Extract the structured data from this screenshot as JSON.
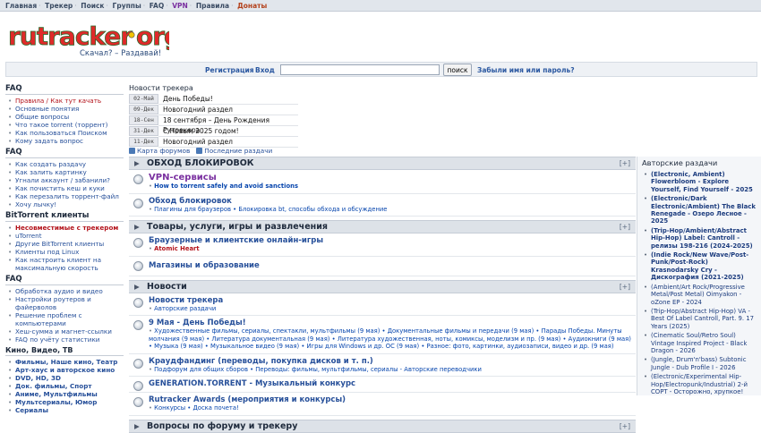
{
  "topnav": [
    "Главная",
    "Трекер",
    "Поиск",
    "Группы",
    "FAQ",
    "VPN",
    "Правила",
    "Донаты"
  ],
  "logo": {
    "text": "rutracker.org",
    "slogan": "Скачал? – Раздавай!"
  },
  "login": {
    "register": "Регистрация",
    "login": "Вход",
    "search_value": "",
    "search_button": "поиск",
    "forgot": "Забыли имя или пароль?"
  },
  "left": {
    "faq1": {
      "title": "FAQ",
      "items": [
        "Правила / Как тут качать",
        "Основные понятия",
        "Общие вопросы",
        "Что такое torrent (торрент)",
        "Как пользоваться Поиском",
        "Кому задать вопрос"
      ]
    },
    "faq2": {
      "title": "FAQ",
      "items": [
        "Как создать раздачу",
        "Как залить картинку",
        "Угнали аккаунт / забанили?",
        "Как почистить кеш и куки",
        "Как перезалить торрент-файл",
        "Хочу лычку!"
      ]
    },
    "bt": {
      "title": "BitTorrent клиенты",
      "items": [
        "Несовместимые с трекером",
        "uTorrent",
        "Другие BitTorrent клиенты",
        "Клиенты под Linux",
        "Как настроить клиент на максимальную скорость"
      ]
    },
    "faq3": {
      "title": "FAQ",
      "items": [
        "Обработка аудио и видео",
        "Настройки роутеров и файерволов",
        "Решение проблем с компьютерами",
        "Хеш-сумма и магнет-ссылки",
        "FAQ по учёту статистики"
      ]
    },
    "tv": {
      "title": "Кино, Видео, ТВ",
      "items": [
        "Фильмы, Наше кино, Театр",
        "Арт-хаус и авторское кино",
        "DVD, HD, 3D",
        "Док. фильмы, Спорт",
        "Аниме, Мультфильмы",
        "Мультсериалы, Юмор",
        "Сериалы"
      ]
    }
  },
  "news": {
    "title": "Новости трекера",
    "items": [
      {
        "date": "02-Май",
        "title": "День Победы!"
      },
      {
        "date": "09-Дек",
        "title": "Новогодний раздел"
      },
      {
        "date": "18-Сен",
        "title": "18 сентября – День Рождения Рутрекера"
      },
      {
        "date": "31-Дек",
        "title": "С Новым 2025 годом!"
      },
      {
        "date": "11-Дек",
        "title": "Новогодний раздел"
      }
    ]
  },
  "maplinks": {
    "forum_map": "Карта форумов",
    "latest": "Последние раздачи"
  },
  "forum": {
    "toggle": "[+]",
    "cat1": {
      "title": "ОБХОД БЛОКИРОВОК",
      "rows": [
        {
          "title": "VPN-сервисы",
          "sub": "How to torrent safely and avoid sanctions"
        },
        {
          "title": "Обход блокировок",
          "sub": "Плагины для браузеров • Блокировка bt, способы обхода и обсуждение"
        }
      ]
    },
    "cat2": {
      "title": "Товары, услуги, игры и развлечения",
      "rows": [
        {
          "title": "Браузерные и клиентские онлайн-игры",
          "sub": "Atomic Heart"
        },
        {
          "title": "Магазины и образование",
          "sub": ""
        }
      ]
    },
    "cat3": {
      "title": "Новости",
      "rows": [
        {
          "title": "Новости трекера",
          "sub": "Авторские раздачи"
        },
        {
          "title": "9 Мая - День Победы!",
          "sub": "Художественные фильмы, сериалы, спектакли, мультфильмы (9 мая) • Документальные фильмы и передачи (9 мая) • Парады Победы. Минуты молчания (9 мая) • Литература документальная (9 мая) • Литература художественная, ноты, комиксы, моделизм и пр. (9 мая) • Аудиокниги (9 мая) • Музыка (9 мая) • Музыкальное видео (9 мая) • Игры для Windows и др. ОС (9 мая) • Разное: фото, картинки, аудиозаписи, видео и др. (9 мая)"
        },
        {
          "title": "Краудфандинг (переводы, покупка дисков и т. п.)",
          "sub": "Подфорум для общих сборов • Переводы: фильмы, мультфильмы, сериалы - Авторские переводчики"
        },
        {
          "title": "GENERATION.TORRENT - Музыкальный конкурс",
          "sub": ""
        },
        {
          "title": "Rutracker Awards (мероприятия и конкурсы)",
          "sub": "Конкурсы • Доска почета!"
        }
      ]
    },
    "cat4": {
      "title": "Вопросы по форуму и трекеру"
    }
  },
  "right": {
    "title": "Авторские раздачи",
    "items": [
      {
        "text": "(Electronic, Ambient) Flowerbloom - Explore Yourself, Find Yourself - 2025",
        "bold": true
      },
      {
        "text": "(Electronic/Dark Electronic/Ambient) The Black Renegade - Озеро Лесное - 2025",
        "bold": true
      },
      {
        "text": "(Trip-Hop/Ambient/Abstract Hip-Hop) Label: Cantroll - релизы 198-216 (2024-2025)",
        "bold": true
      },
      {
        "text": "(Indie Rock/New Wave/Post-Punk/Post-Rock) Krasnodarsky Cry - Дискография (2021-2025)",
        "bold": true
      },
      {
        "text": "(Ambient/Art Rock/Progressive Metal/Post Metal) Oimyakon - oZone EP - 2024",
        "bold": false
      },
      {
        "text": "(Trip-Hop/Abstract Hip-Hop) VA - Best Of Label Cantroll, Part. 9. 17 Years (2025)",
        "bold": false
      },
      {
        "text": "(Cinematic Soul/Retro Soul) Vintage Inspired Project - Black Dragon - 2026",
        "bold": false
      },
      {
        "text": "(Jungle, Drum'n'bass) Subtonic Jungle - Dub Profile I - 2026",
        "bold": false
      },
      {
        "text": "(Electronic/Experimental Hip-Hop/Electropunk/Industrial) 2-й СОРТ - Осторожно, хрупкое! (2025)",
        "bold": false
      }
    ]
  }
}
